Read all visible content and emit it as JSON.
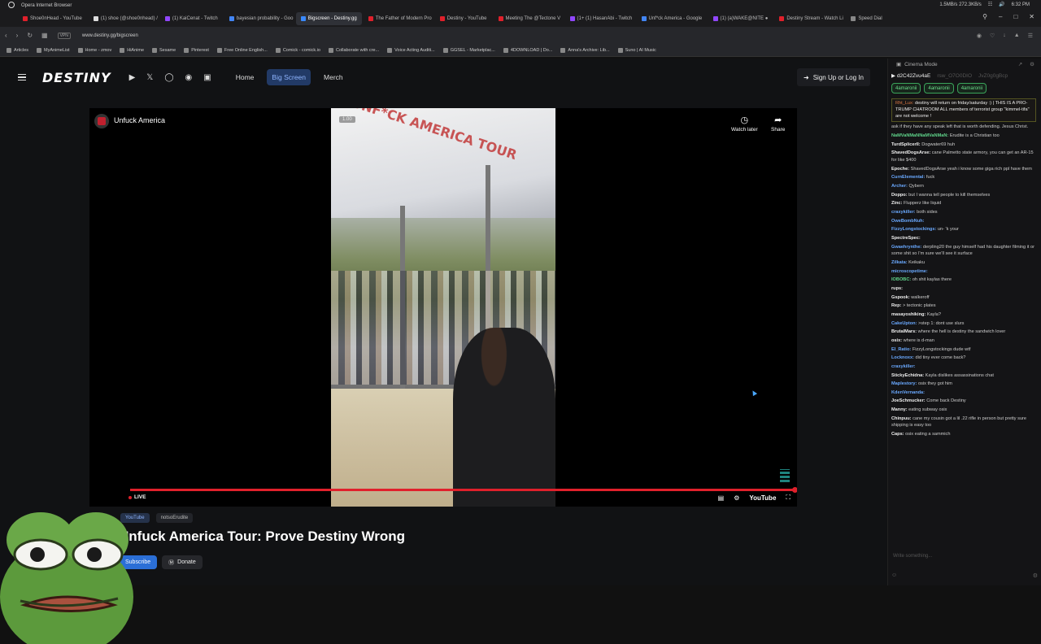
{
  "os": {
    "title": "Opera Internet Browser",
    "time": "6:32 PM",
    "net": "1.5MB/s 272.3KB/s"
  },
  "tabs": [
    {
      "label": "Shoe0nHead - YouTube",
      "color": "#e0202b"
    },
    {
      "label": "(1) shoe (@shoe0nhead) /",
      "color": "#ddd"
    },
    {
      "label": "(1) KaiCenat - Twitch",
      "color": "#9147ff"
    },
    {
      "label": "bayesian probability - Goo",
      "color": "#4285f4"
    },
    {
      "label": "Bigscreen - Destiny.gg",
      "color": "#3a8aff",
      "active": true
    },
    {
      "label": "The Father of Modern Pro",
      "color": "#e0202b"
    },
    {
      "label": "Destiny - YouTube",
      "color": "#e0202b"
    },
    {
      "label": "Meeting The @Tectone V",
      "color": "#e0202b"
    },
    {
      "label": "(1+ (1) HasanAbi - Twitch",
      "color": "#9147ff"
    },
    {
      "label": "Unf*ck America - Google",
      "color": "#4285f4"
    },
    {
      "label": "(1) (a)WAKE@NITE ●",
      "color": "#9147ff"
    },
    {
      "label": "Destiny Stream - Watch Li",
      "color": "#e0202b"
    },
    {
      "label": "Speed Dial",
      "color": "#888"
    }
  ],
  "address": {
    "vpn": "VPN",
    "url": "www.destiny.gg/bigscreen"
  },
  "bookmarks": [
    "Articles",
    "MyAnimeList",
    "Home - zmov",
    "HiAnime",
    "Sesame",
    "Pinterest",
    "Free Online English...",
    "Comick - comick.io",
    "Collaborate with cre...",
    "Voice Acting Auditi...",
    "GGSEL - Marketplac...",
    "4DOWNLOAD | Do...",
    "Anna's Archive: Lib...",
    "Suno | AI Music"
  ],
  "site": {
    "logo": "DESTINY",
    "nav": {
      "home": "Home",
      "bigscreen": "Big Screen",
      "merch": "Merch"
    },
    "signin": "Sign Up or Log In"
  },
  "player": {
    "channel": "Unfuck America",
    "speed": "1.00",
    "watch_later": "Watch later",
    "share": "Share",
    "live": "LIVE",
    "youtube": "YouTube",
    "progress": 1.0,
    "tent_text": "UNF*CK AMERICA TOUR"
  },
  "below": {
    "tags": [
      "YouTube",
      "notsoErudite"
    ],
    "title": "Unfuck America Tour: Prove Destiny Wrong",
    "subscribe": "Subscribe",
    "donate": "Donate"
  },
  "chat": {
    "cinema": "Cinema Mode",
    "users": [
      "d2C42Zvu4aE",
      "rsw_O7O0DIO",
      "JvZ0g0gBcp"
    ],
    "pills": [
      "4amaronii",
      "4amaronii",
      "4amaronii"
    ],
    "notice_user": "Rht_Lux:",
    "notice": "destiny will return on friday/saturday :) | THIS IS A PRO-TRUMP CHATROOM ALL members of terrorist group \"kimmel-tifa\" are not welcome !",
    "messages": [
      {
        "u": "",
        "c": "#ccc",
        "t": "ask if they have any speak left that is worth defending. Jesus Christ."
      },
      {
        "u": "NaMVaNMaNNaMVaNMaN:",
        "c": "#5fd38a",
        "t": "Erudite is a Christian too"
      },
      {
        "u": "TurdSplicerII:",
        "c": "#eee",
        "t": "Dogwater69 huh"
      },
      {
        "u": "ShavedDogsArse:",
        "c": "#eee",
        "t": "cane Palmetto state armory, you can get an AR-15 for like $400"
      },
      {
        "u": "Epoche:",
        "c": "#eee",
        "t": "ShavedDogsArse yeah i know some giga rich ppl have them"
      },
      {
        "u": "CurnElemental:",
        "c": "#6aa9ff",
        "t": "fuck"
      },
      {
        "u": "Archer:",
        "c": "#6aa9ff",
        "t": "Qybern"
      },
      {
        "u": "Doppo:",
        "c": "#eee",
        "t": "but I wanna tell people to kill themselves"
      },
      {
        "u": "Zinc:",
        "c": "#eee",
        "t": "Flupperz like liquid"
      },
      {
        "u": "craxykiller:",
        "c": "#6aa9ff",
        "t": "both sides"
      },
      {
        "u": "OweBombNuh:",
        "c": "#6aa9ff",
        "t": ""
      },
      {
        "u": "FizzyLongstockings:",
        "c": "#6aa9ff",
        "t": "un- 'k your"
      },
      {
        "u": "SpectreSpec:",
        "c": "#eee",
        "t": ""
      },
      {
        "u": "Gwaehrynthe:",
        "c": "#6aa9ff",
        "t": "derpling20 the guy himself had his daughter filming it or some shit so I'm sure we'll see it surface"
      },
      {
        "u": "Zilkata:",
        "c": "#6aa9ff",
        "t": "Keikaku"
      },
      {
        "u": "microscopetime:",
        "c": "#6aa9ff",
        "t": ""
      },
      {
        "u": "IOBOBC:",
        "c": "#5fd38a",
        "t": "oh shit kaylas there"
      },
      {
        "u": "rups:",
        "c": "#eee",
        "t": ""
      },
      {
        "u": "Gspook:",
        "c": "#eee",
        "t": "walkeroff"
      },
      {
        "u": "Rep:",
        "c": "#eee",
        "t": "> tectonic plates"
      },
      {
        "u": "masayoshiking:",
        "c": "#eee",
        "t": "Kayla?"
      },
      {
        "u": "CakeUpton:",
        "c": "#6aa9ff",
        "t": ">step 1: dont use slurs"
      },
      {
        "u": "BrutalMars:",
        "c": "#eee",
        "t": "where the hell is destiny the sandwich lover"
      },
      {
        "u": "osix:",
        "c": "#eee",
        "t": "where is d-man"
      },
      {
        "u": "El_Ratio:",
        "c": "#6aa9ff",
        "t": "FizzyLongstockings dude wtf"
      },
      {
        "u": "Locknoxx:",
        "c": "#6aa9ff",
        "t": "did tiny ever come back?"
      },
      {
        "u": "craxykiller:",
        "c": "#6aa9ff",
        "t": ""
      },
      {
        "u": "StickyEchidna:",
        "c": "#eee",
        "t": "Kayla dislikes assassinations chat"
      },
      {
        "u": "Maplestory:",
        "c": "#6aa9ff",
        "t": "osix they got him"
      },
      {
        "u": "KdenVernanda:",
        "c": "#6aa9ff",
        "t": ""
      },
      {
        "u": "JoeSchmucker:",
        "c": "#eee",
        "t": "Come back Destiny"
      },
      {
        "u": "Manny:",
        "c": "#eee",
        "t": "eating subway osix"
      },
      {
        "u": "Chinpuu:",
        "c": "#eee",
        "t": "cane my cousin got a lil .22 rifle in person but pretty sure shipping is easy too"
      },
      {
        "u": "Caps:",
        "c": "#eee",
        "t": "osix eating a sammich"
      }
    ],
    "placeholder": "Write something..."
  }
}
